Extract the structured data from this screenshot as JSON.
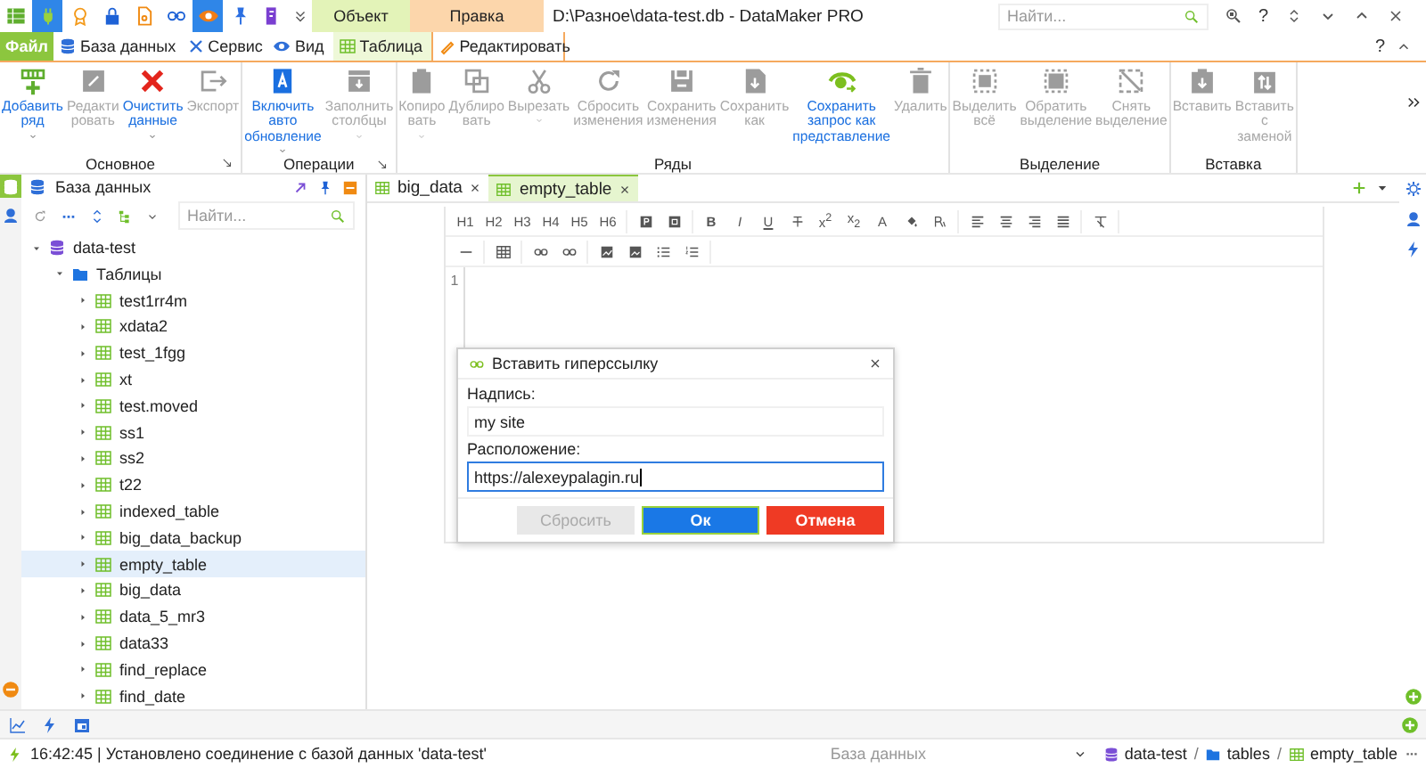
{
  "quick_access": [
    {
      "kind": "app",
      "on": false
    },
    {
      "kind": "plug",
      "on": true
    },
    {
      "kind": "badge",
      "on": false
    },
    {
      "kind": "lock",
      "on": false
    },
    {
      "kind": "file",
      "on": false
    },
    {
      "kind": "link",
      "on": false
    },
    {
      "kind": "eye",
      "on": true
    },
    {
      "kind": "pin",
      "on": false
    },
    {
      "kind": "form",
      "on": false
    }
  ],
  "context_tabs": [
    {
      "label": "Объект",
      "kind": "object"
    },
    {
      "label": "Правка",
      "kind": "edit"
    }
  ],
  "window": {
    "title": "D:\\Разное\\data-test.db - DataMaker PRO",
    "search_placeholder": "Найти...",
    "help": "?"
  },
  "menu_tabs": [
    {
      "label": "Файл",
      "kind": "file",
      "selected": false
    },
    {
      "label": "База данных",
      "kind": "database",
      "selected": false
    },
    {
      "label": "Сервис",
      "kind": "service",
      "selected": false
    },
    {
      "label": "Вид",
      "kind": "view",
      "selected": false
    },
    {
      "label": "Таблица",
      "kind": "table",
      "selected": false
    },
    {
      "label": "Редактировать",
      "kind": "edit",
      "selected": true
    }
  ],
  "ribbon_help": "?",
  "ribbon": [
    {
      "label": "Основное",
      "launcher": true,
      "buttons": [
        {
          "kind": "add",
          "lines": [
            "Добавить",
            "ряд"
          ],
          "disabled": false,
          "dropdown": true
        },
        {
          "kind": "edit",
          "lines": [
            "Редакти",
            "ровать"
          ],
          "disabled": true,
          "dropdown": false
        },
        {
          "kind": "clear",
          "lines": [
            "Очистить",
            "данные"
          ],
          "disabled": false,
          "dropdown": true
        },
        {
          "kind": "export",
          "lines": [
            "Экспорт"
          ],
          "disabled": true,
          "dropdown": false
        }
      ]
    },
    {
      "label": "Операции",
      "launcher": true,
      "buttons": [
        {
          "kind": "auto",
          "lines": [
            "Включить",
            "авто",
            "обновление"
          ],
          "disabled": false,
          "dropdown": true
        },
        {
          "kind": "fill",
          "lines": [
            "Заполнить",
            "столбцы"
          ],
          "disabled": true,
          "dropdown": true
        }
      ]
    },
    {
      "label": "Ряды",
      "launcher": false,
      "buttons": [
        {
          "kind": "copy",
          "lines": [
            "Копиро",
            "вать"
          ],
          "disabled": true,
          "dropdown": true
        },
        {
          "kind": "duplicate",
          "lines": [
            "Дублиро",
            "вать"
          ],
          "disabled": true,
          "dropdown": false
        },
        {
          "kind": "cut",
          "lines": [
            "Вырезать"
          ],
          "disabled": true,
          "dropdown": true
        },
        {
          "kind": "reset",
          "lines": [
            "Сбросить",
            "изменения"
          ],
          "disabled": true,
          "dropdown": false
        },
        {
          "kind": "save",
          "lines": [
            "Сохранить",
            "изменения"
          ],
          "disabled": true,
          "dropdown": false
        },
        {
          "kind": "saveas",
          "lines": [
            "Сохранить",
            "как"
          ],
          "disabled": true,
          "dropdown": false
        },
        {
          "kind": "view",
          "lines": [
            "Сохранить",
            "запрос как",
            "представление"
          ],
          "disabled": false,
          "dropdown": false
        },
        {
          "kind": "delete",
          "lines": [
            "Удалить"
          ],
          "disabled": true,
          "dropdown": false
        }
      ]
    },
    {
      "label": "Выделение",
      "launcher": false,
      "buttons": [
        {
          "kind": "selectall",
          "lines": [
            "Выделить",
            "всё"
          ],
          "disabled": true,
          "dropdown": false
        },
        {
          "kind": "invert",
          "lines": [
            "Обратить",
            "выделение"
          ],
          "disabled": true,
          "dropdown": false
        },
        {
          "kind": "deselect",
          "lines": [
            "Снять",
            "выделение"
          ],
          "disabled": true,
          "dropdown": false
        }
      ]
    },
    {
      "label": "Вставка",
      "launcher": false,
      "buttons": [
        {
          "kind": "paste",
          "lines": [
            "Вставить"
          ],
          "disabled": true,
          "dropdown": false
        },
        {
          "kind": "pastereplace",
          "lines": [
            "Вставить",
            "с",
            "заменой"
          ],
          "disabled": true,
          "dropdown": false
        }
      ]
    }
  ],
  "sidebar": {
    "title": "База данных",
    "search_placeholder": "Найти..."
  },
  "tree": [
    {
      "label": "data-test",
      "kind": "database",
      "expanded": true,
      "selected": false,
      "children": [
        {
          "label": "Таблицы",
          "kind": "folder",
          "expanded": true,
          "selected": false,
          "children": [
            {
              "label": "test1rr4m",
              "kind": "table",
              "expanded": false,
              "selected": false
            },
            {
              "label": "xdata2",
              "kind": "table",
              "expanded": false,
              "selected": false
            },
            {
              "label": "test_1fgg",
              "kind": "table",
              "expanded": false,
              "selected": false
            },
            {
              "label": "xt",
              "kind": "table",
              "expanded": false,
              "selected": false
            },
            {
              "label": "test.moved",
              "kind": "table",
              "expanded": false,
              "selected": false
            },
            {
              "label": "ss1",
              "kind": "table",
              "expanded": false,
              "selected": false
            },
            {
              "label": "ss2",
              "kind": "table",
              "expanded": false,
              "selected": false
            },
            {
              "label": "t22",
              "kind": "table",
              "expanded": false,
              "selected": false
            },
            {
              "label": "indexed_table",
              "kind": "table",
              "expanded": false,
              "selected": false
            },
            {
              "label": "big_data_backup",
              "kind": "table",
              "expanded": false,
              "selected": false
            },
            {
              "label": "empty_table",
              "kind": "table",
              "expanded": false,
              "selected": true
            },
            {
              "label": "big_data",
              "kind": "table",
              "expanded": false,
              "selected": false
            },
            {
              "label": "data_5_mr3",
              "kind": "table",
              "expanded": false,
              "selected": false
            },
            {
              "label": "data33",
              "kind": "table",
              "expanded": false,
              "selected": false
            },
            {
              "label": "find_replace",
              "kind": "table",
              "expanded": false,
              "selected": false
            },
            {
              "label": "find_date",
              "kind": "table",
              "expanded": false,
              "selected": false
            }
          ]
        }
      ]
    }
  ],
  "doc_tabs": [
    {
      "label": "big_data",
      "selected": false
    },
    {
      "label": "empty_table",
      "selected": true
    }
  ],
  "editor_toolbar": {
    "row1": [
      [
        {
          "kind": "text",
          "label": "H1"
        },
        {
          "kind": "text",
          "label": "H2"
        },
        {
          "kind": "text",
          "label": "H3"
        },
        {
          "kind": "text",
          "label": "H4"
        },
        {
          "kind": "text",
          "label": "H5"
        },
        {
          "kind": "text",
          "label": "H6"
        }
      ],
      [
        {
          "kind": "paragraph"
        },
        {
          "kind": "quote"
        }
      ],
      [
        {
          "kind": "bold",
          "label": "B"
        },
        {
          "kind": "italic",
          "label": "I"
        },
        {
          "kind": "underline",
          "label": "U"
        },
        {
          "kind": "strike"
        },
        {
          "kind": "text",
          "label": "x$^{2}$"
        },
        {
          "kind": "text",
          "label": "x$_{2}$"
        },
        {
          "kind": "text",
          "label": "A"
        },
        {
          "kind": "paint"
        },
        {
          "kind": "clearstyle"
        }
      ],
      [
        {
          "kind": "alignleft"
        },
        {
          "kind": "aligncenter"
        },
        {
          "kind": "alignright"
        },
        {
          "kind": "justify"
        }
      ],
      [
        {
          "kind": "clearformat"
        }
      ]
    ],
    "row2": [
      [
        {
          "kind": "rule"
        }
      ],
      [
        {
          "kind": "table"
        }
      ],
      [
        {
          "kind": "link"
        },
        {
          "kind": "unlink"
        }
      ],
      [
        {
          "kind": "imageedit"
        },
        {
          "kind": "image"
        },
        {
          "kind": "bullets"
        },
        {
          "kind": "numbers"
        }
      ]
    ]
  },
  "line_numbers": [
    "1"
  ],
  "dialog": {
    "title": "Вставить гиперссылку",
    "caption_label": "Надпись:",
    "caption_value": "my site",
    "location_label": "Расположение:",
    "location_value": "https://alexeypalagin.ru",
    "buttons": [
      {
        "label": "Сбросить",
        "kind": "reset",
        "disabled": true
      },
      {
        "label": "Ок",
        "kind": "ok",
        "disabled": false
      },
      {
        "label": "Отмена",
        "kind": "cancel",
        "disabled": false
      }
    ]
  },
  "status_bar": {
    "message": "16:42:45 | Установлено соединение с базой данных 'data-test'",
    "scope_placeholder": "База данных",
    "separator": "/",
    "breadcrumb": [
      {
        "label": "data-test",
        "kind": "database"
      },
      {
        "label": "tables",
        "kind": "folder"
      },
      {
        "label": "empty_table",
        "kind": "table"
      }
    ]
  }
}
